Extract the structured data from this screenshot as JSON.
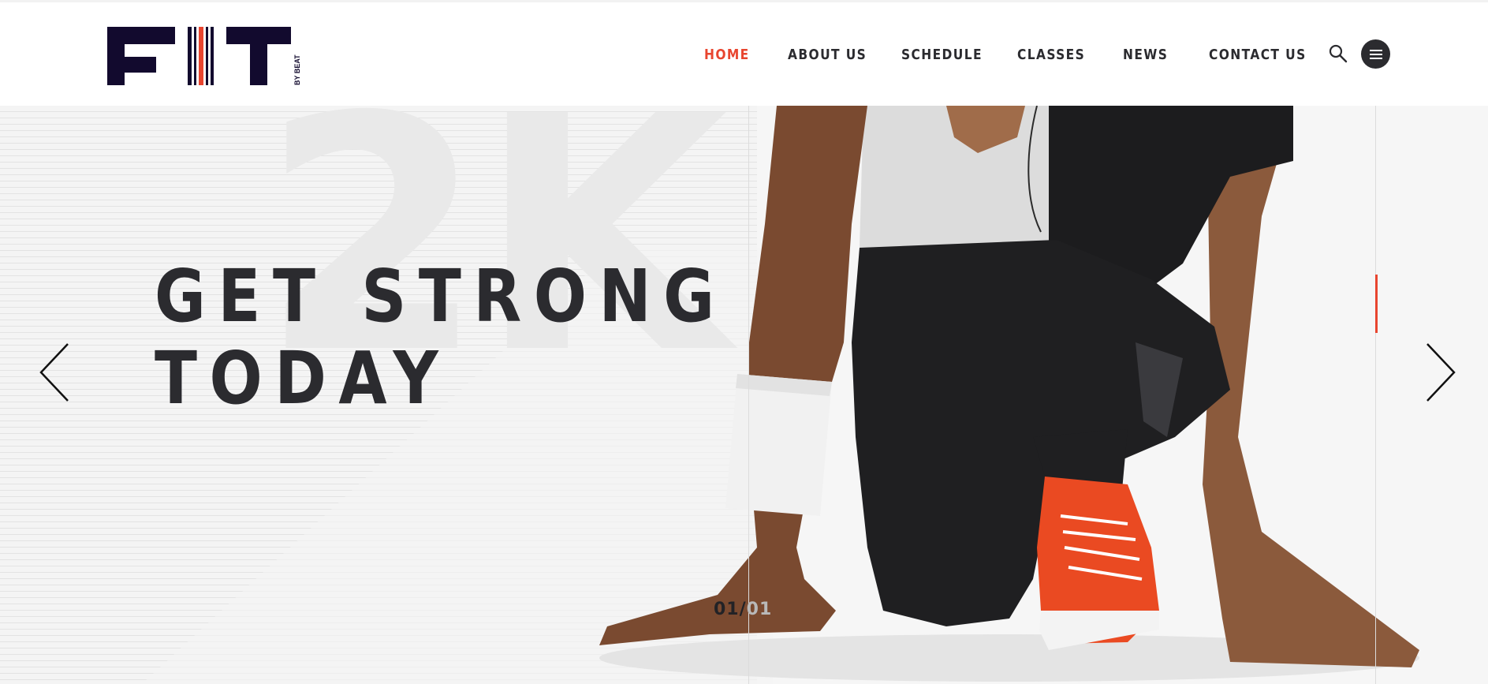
{
  "logo": {
    "letters": "FIT",
    "tagline": "BY BEAT"
  },
  "nav": {
    "items": [
      {
        "label": "HOME",
        "active": true
      },
      {
        "label": "ABOUT US",
        "active": false
      },
      {
        "label": "SCHEDULE",
        "active": false
      },
      {
        "label": "CLASSES",
        "active": false
      },
      {
        "label": "NEWS",
        "active": false
      },
      {
        "label": "CONTACT US",
        "active": false
      }
    ],
    "search_icon": "search-icon",
    "menu_icon": "hamburger-menu-icon"
  },
  "hero": {
    "background_text": "2K",
    "headline_line1": "GET STRONG",
    "headline_line2": "TODAY",
    "counter_current": "01/",
    "counter_total": "01",
    "prev_icon": "chevron-left-icon",
    "next_icon": "chevron-right-icon"
  },
  "colors": {
    "accent": "#e8452f",
    "text_dark": "#2b2b2f",
    "logo_navy": "#120a2e"
  }
}
